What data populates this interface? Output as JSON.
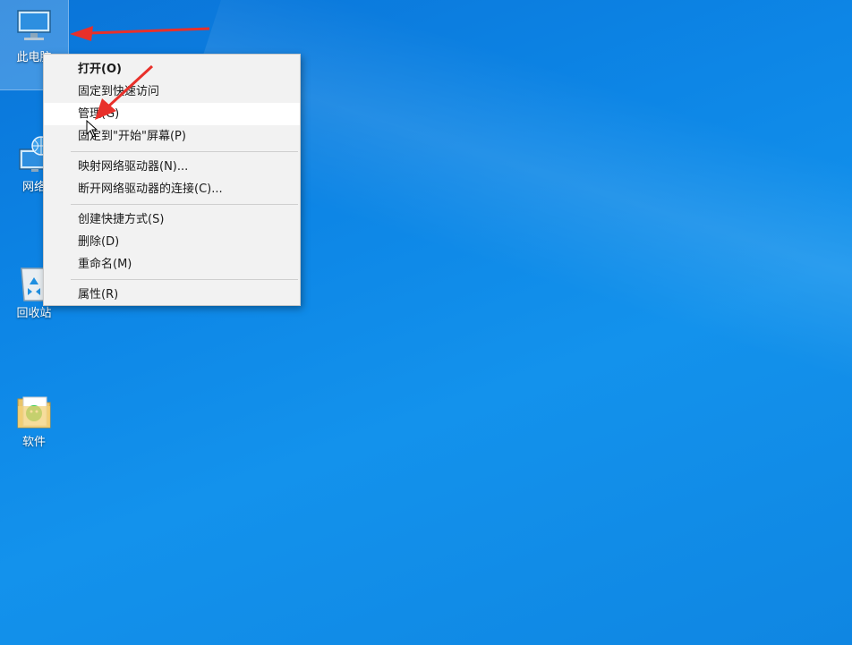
{
  "desktop": {
    "icons": [
      {
        "label": "此电脑",
        "icon": "computer-icon"
      },
      {
        "label": "网络",
        "icon": "network-icon"
      },
      {
        "label": "回收站",
        "icon": "recycle-bin-icon"
      },
      {
        "label": "软件",
        "icon": "folder-icon"
      }
    ]
  },
  "context_menu": {
    "items": [
      {
        "label": "打开(O)"
      },
      {
        "label": "固定到快速访问"
      },
      {
        "label": "管理(G)"
      },
      {
        "label": "固定到\"开始\"屏幕(P)"
      },
      {
        "label": "映射网络驱动器(N)..."
      },
      {
        "label": "断开网络驱动器的连接(C)..."
      },
      {
        "label": "创建快捷方式(S)"
      },
      {
        "label": "删除(D)"
      },
      {
        "label": "重命名(M)"
      },
      {
        "label": "属性(R)"
      }
    ]
  },
  "colors": {
    "annotation_arrow": "#e8302a",
    "desktop_bg": "#0d86e6"
  }
}
